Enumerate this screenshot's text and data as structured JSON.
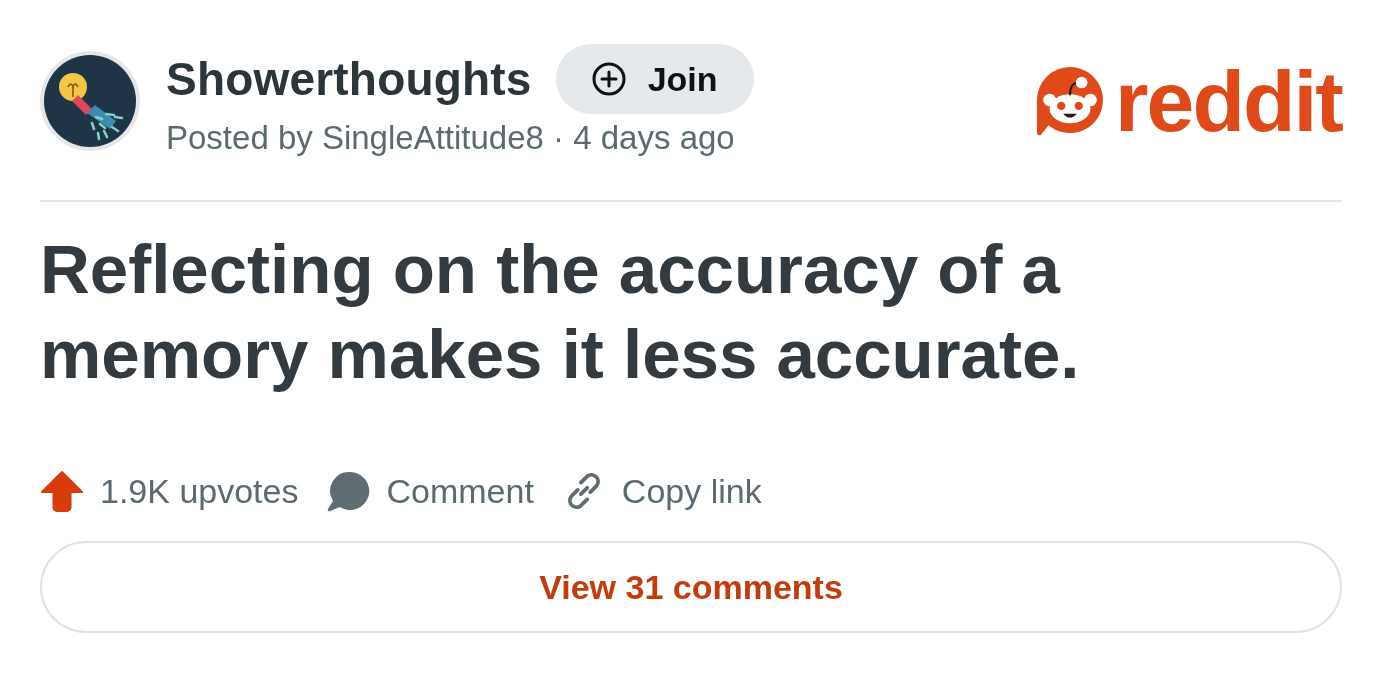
{
  "community": {
    "name": "Showerthoughts",
    "join_label": "Join",
    "posted_by": "Posted by SingleAttitude8 · 4 days ago"
  },
  "brand": {
    "wordmark": "reddit"
  },
  "post": {
    "title": "Reflecting on the accuracy of a memory makes it less accurate."
  },
  "votes": {
    "label": "1.9K upvotes",
    "upvoted": true
  },
  "actions": [
    {
      "kind": "comment",
      "label": "Comment"
    },
    {
      "kind": "link",
      "label": "Copy link"
    }
  ],
  "view_comments": {
    "label": "View 31 comments"
  }
}
